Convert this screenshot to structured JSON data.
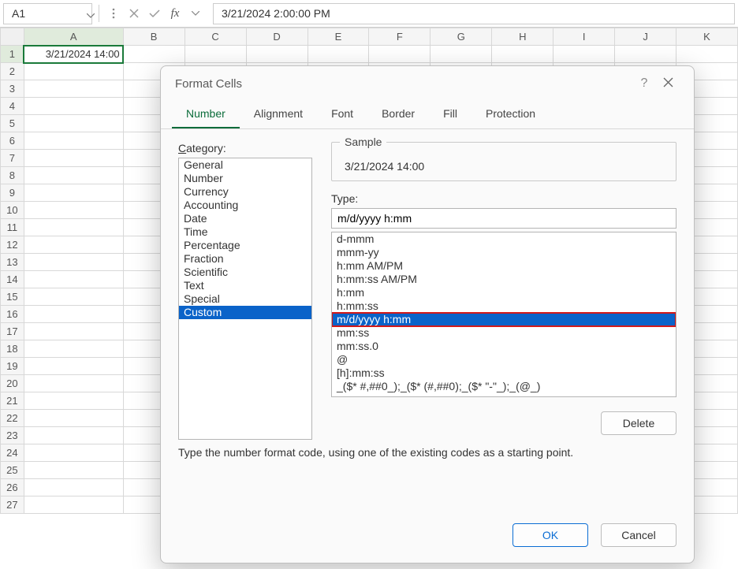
{
  "formula_bar": {
    "cell_ref": "A1",
    "value": "3/21/2024  2:00:00 PM"
  },
  "columns": [
    "A",
    "B",
    "C",
    "D",
    "E",
    "F",
    "G",
    "H",
    "I",
    "J",
    "K"
  ],
  "rows_count": 27,
  "cells": {
    "A1": "3/21/2024 14:00"
  },
  "dialog": {
    "title": "Format Cells",
    "tabs": [
      "Number",
      "Alignment",
      "Font",
      "Border",
      "Fill",
      "Protection"
    ],
    "active_tab": "Number",
    "category_label": "Category:",
    "categories": [
      "General",
      "Number",
      "Currency",
      "Accounting",
      "Date",
      "Time",
      "Percentage",
      "Fraction",
      "Scientific",
      "Text",
      "Special",
      "Custom"
    ],
    "selected_category": "Custom",
    "sample_label": "Sample",
    "sample_value": "3/21/2024 14:00",
    "type_label": "Type:",
    "type_value": "m/d/yyyy h:mm",
    "type_list": [
      "d-mmm",
      "mmm-yy",
      "h:mm AM/PM",
      "h:mm:ss AM/PM",
      "h:mm",
      "h:mm:ss",
      "m/d/yyyy h:mm",
      "mm:ss",
      "mm:ss.0",
      "@",
      "[h]:mm:ss",
      "_($* #,##0_);_($* (#,##0);_($* \"-\"_);_(@_)"
    ],
    "selected_type": "m/d/yyyy h:mm",
    "delete": "Delete",
    "hint": "Type the number format code, using one of the existing codes as a starting point.",
    "ok": "OK",
    "cancel": "Cancel"
  }
}
